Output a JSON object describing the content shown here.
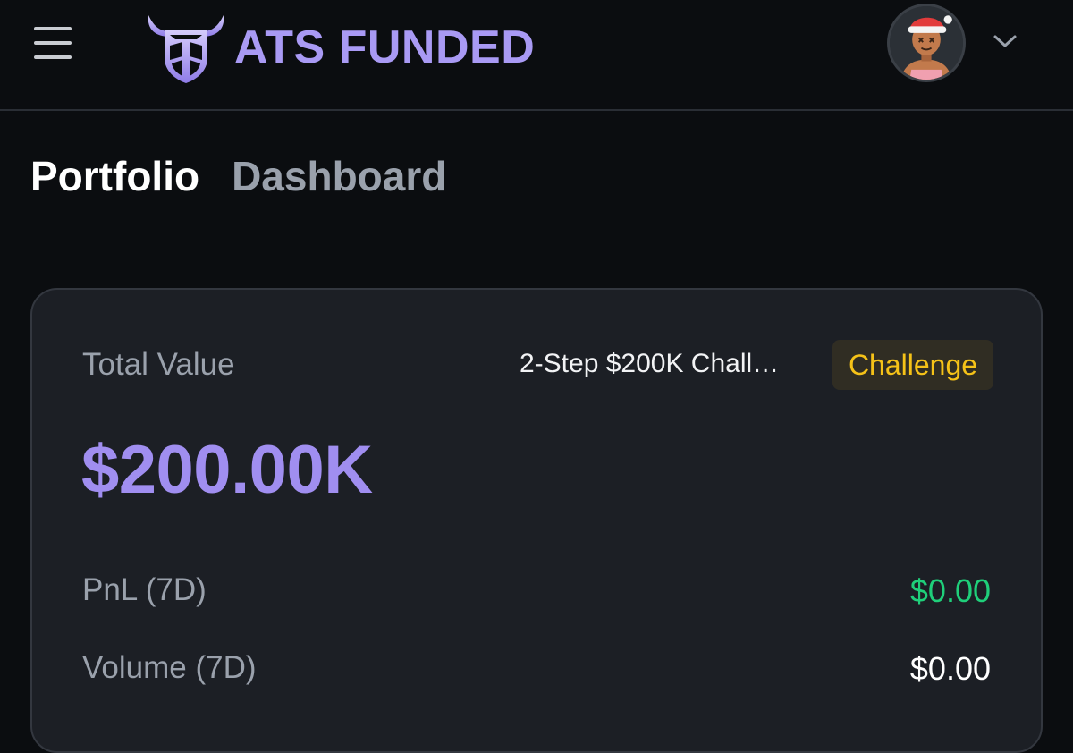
{
  "header": {
    "menu_icon": "hamburger-menu-icon",
    "brand_name": "ATS FUNDED",
    "logo_icon": "bull-shield-logo",
    "avatar_icon": "user-avatar-santa-hat",
    "dropdown_icon": "chevron-down-icon"
  },
  "tabs": [
    {
      "label": "Portfolio",
      "active": true
    },
    {
      "label": "Dashboard",
      "active": false
    }
  ],
  "portfolio_card": {
    "total_value_label": "Total Value",
    "challenge_name": "2-Step $200K Chall…",
    "badge_label": "Challenge",
    "total_value": "$200.00K",
    "pnl_label": "PnL (7D)",
    "pnl_value": "$0.00",
    "volume_label": "Volume (7D)",
    "volume_value": "$0.00"
  },
  "colors": {
    "background": "#0b0d10",
    "card": "#1c1f25",
    "accent_purple": "#a08ef0",
    "badge_yellow": "#f5c218",
    "positive_green": "#1fcf7a"
  }
}
